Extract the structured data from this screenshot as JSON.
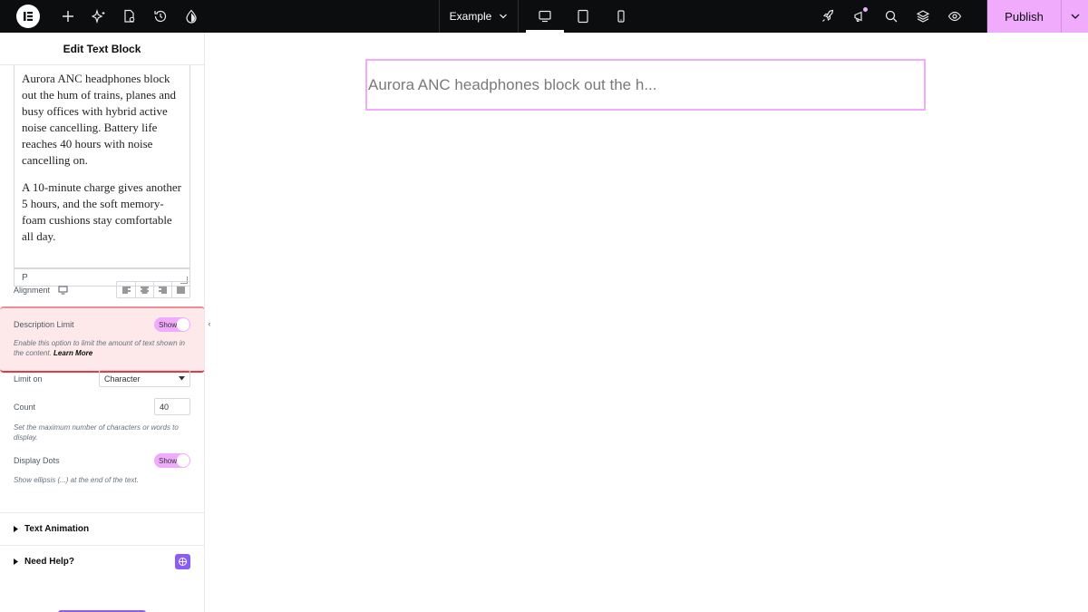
{
  "topbar": {
    "doc_title": "Example",
    "publish_label": "Publish",
    "colors": {
      "background": "#0c0d0e",
      "accent": "#f0abfc"
    },
    "left_icons": [
      "add-icon",
      "ai-sparkle-icon",
      "page-settings-icon",
      "history-icon",
      "site-styles-icon"
    ],
    "right_icons": [
      "rocket-icon",
      "notifications-icon",
      "search-icon",
      "layers-icon",
      "preview-eye-icon"
    ],
    "devices": [
      "desktop-icon",
      "tablet-icon",
      "mobile-icon"
    ]
  },
  "panel": {
    "title": "Edit Text Block",
    "editor": {
      "paragraphs": [
        "Aurora ANC headphones block out the hum of trains, planes and busy offices with hybrid active noise cancelling. Battery life reaches 40 hours with noise cancelling on.",
        "A 10-minute charge gives another 5 hours, and the soft memory-foam cushions stay comfortable all day."
      ],
      "status_tag": "P"
    },
    "alignment_label": "Alignment",
    "description_limit": {
      "label": "Description Limit",
      "toggle": "Show",
      "help_text": "Enable this option to limit the amount of text shown in the content.",
      "learn_more": "Learn More"
    },
    "limit_on": {
      "label": "Limit on",
      "value": "Character"
    },
    "count": {
      "label": "Count",
      "value": "40",
      "help_text": "Set the maximum number of characters or words to display."
    },
    "display_dots": {
      "label": "Display Dots",
      "toggle": "Show",
      "help_text": "Show ellipsis (...) at the end of the text."
    },
    "sections": {
      "text_animation": "Text Animation",
      "need_help": "Need Help?"
    }
  },
  "canvas": {
    "preview_text": "Aurora ANC headphones block out the h..."
  }
}
